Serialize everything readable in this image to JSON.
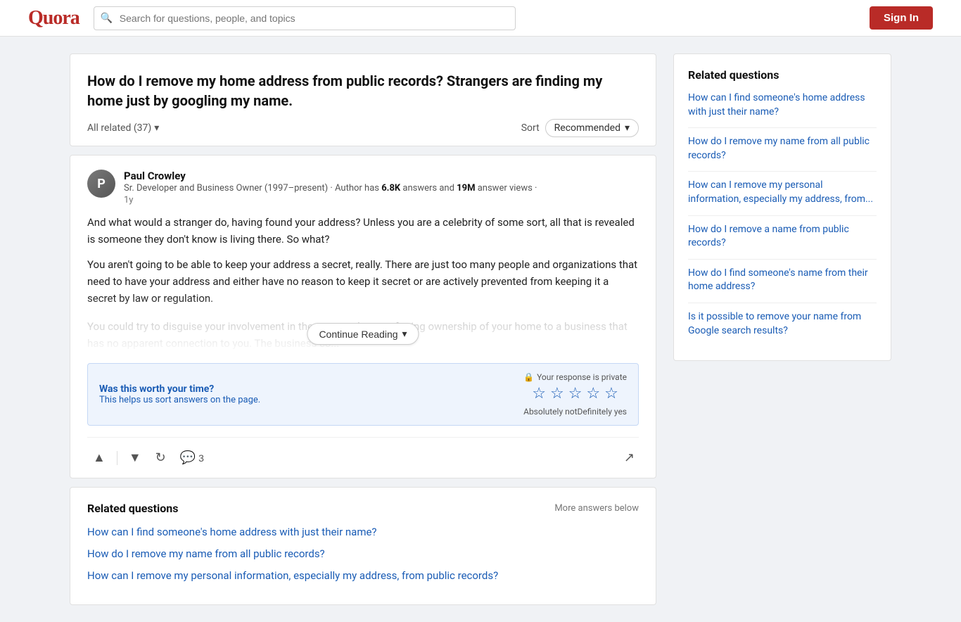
{
  "header": {
    "logo": "Quora",
    "search_placeholder": "Search for questions, people, and topics",
    "sign_in_label": "Sign In"
  },
  "question": {
    "title": "How do I remove my home address from public records? Strangers are finding my home just by googling my name."
  },
  "sort_bar": {
    "all_related_label": "All related (37)",
    "sort_label": "Sort",
    "sort_value": "Recommended",
    "chevron": "▾"
  },
  "answer": {
    "author_name": "Paul Crowley",
    "author_bio_prefix": "Sr. Developer and Business Owner (1997–present) · Author has ",
    "author_answers": "6.8K",
    "author_bio_mid": " answers and ",
    "author_views": "19M",
    "author_bio_suffix": " answer views ·",
    "answer_time": "1y",
    "para1": "And what would a stranger do, having found your address? Unless you are a celebrity of some sort, all that is revealed is someone they don't know is living there. So what?",
    "para2": "You aren't going to be able to keep your address a secret, really. There are just too many people and organizations that need to have your address and either have no reason to keep it secret or are actively prevented from keeping it a secret by law or regulation.",
    "para3_faded": "You could try to disguise your involvement in the property by transferring ownership of your home to a business that has no apparent connection to you. The business co...",
    "continue_reading_label": "Continue Reading",
    "private_label": "Your response is private",
    "worth_title": "Was this worth your time?",
    "worth_sub": "This helps us sort answers on the page.",
    "star_labels_left": "Absolutely not",
    "star_labels_right": "Definitely yes",
    "comment_count": "3",
    "upvote_icon": "▲",
    "downvote_icon": "▼",
    "share_icon": "↗"
  },
  "related_bottom": {
    "title": "Related questions",
    "more_label": "More answers below",
    "links": [
      "How can I find someone's home address with just their name?",
      "How do I remove my name from all public records?",
      "How can I remove my personal information, especially my address, from public records?"
    ]
  },
  "sidebar": {
    "title": "Related questions",
    "links": [
      "How can I find someone's home address with just their name?",
      "How do I remove my name from all public records?",
      "How can I remove my personal information, especially my address, from...",
      "How do I remove a name from public records?",
      "How do I find someone's name from their home address?",
      "Is it possible to remove your name from Google search results?"
    ]
  }
}
